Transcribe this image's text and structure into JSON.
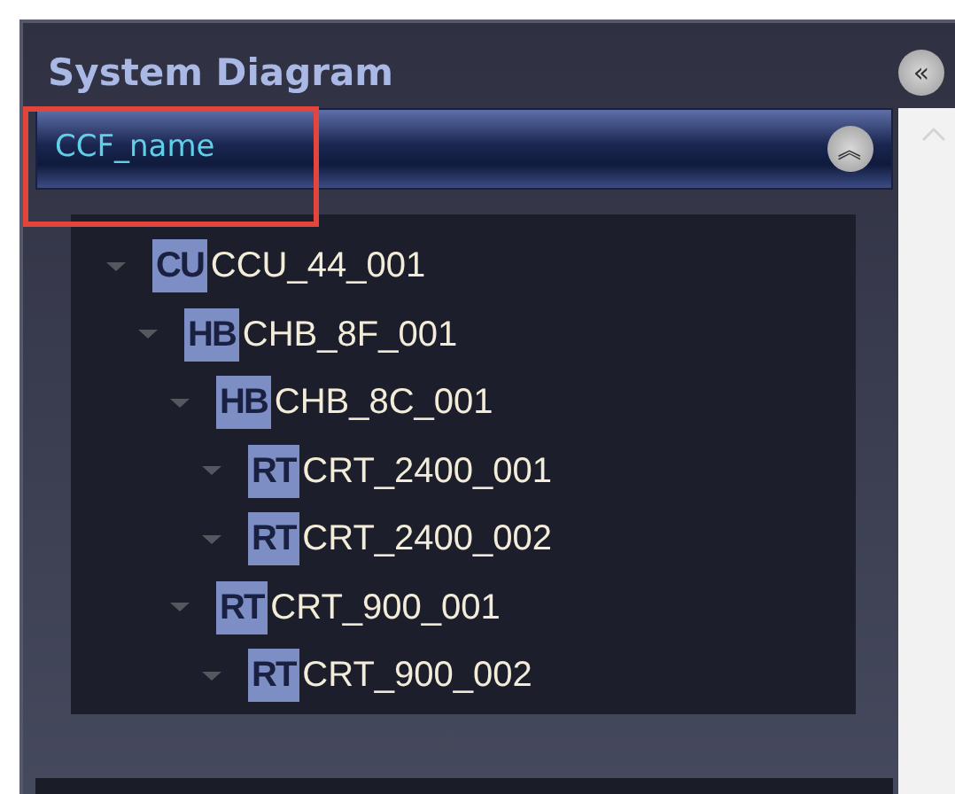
{
  "panel": {
    "title": "System Diagram",
    "collapse_icon": "«"
  },
  "header": {
    "label": "CCF_name",
    "highlighted": true,
    "collapse_icon": "︽"
  },
  "tree": [
    {
      "badge": "CU",
      "label": "CCU_44_001",
      "expanded": true,
      "children": [
        {
          "badge": "HB",
          "label": "CHB_8F_001",
          "expanded": true,
          "children": [
            {
              "badge": "HB",
              "label": "CHB_8C_001",
              "expanded": true,
              "children": [
                {
                  "badge": "RT",
                  "label": "CRT_2400_001",
                  "expanded": true
                },
                {
                  "badge": "RT",
                  "label": "CRT_2400_002",
                  "expanded": true
                }
              ]
            },
            {
              "badge": "RT",
              "label": "CRT_900_001",
              "expanded": true,
              "children": [
                {
                  "badge": "RT",
                  "label": "CRT_900_002",
                  "expanded": true
                }
              ]
            }
          ]
        }
      ]
    }
  ]
}
